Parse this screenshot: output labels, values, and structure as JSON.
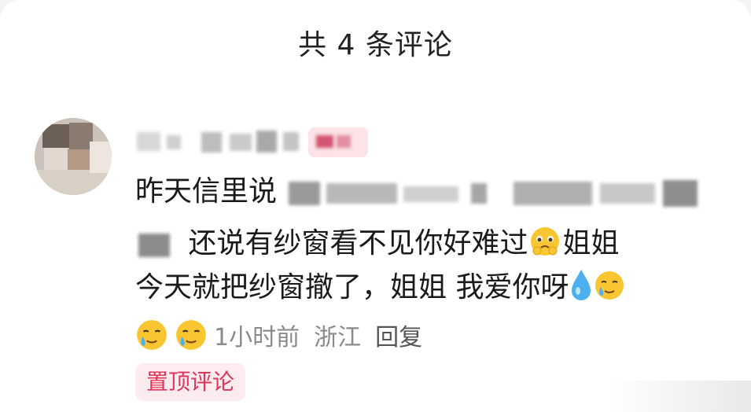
{
  "header": {
    "title": "共 4 条评论"
  },
  "comment": {
    "line1_text": "昨天信里说",
    "line2_text": "还说有纱窗看不见你好难过",
    "line2_tail": "姐姐",
    "line3_text": "今天就把纱窗撤了，姐姐 我爱你呀",
    "emojis": [
      "holding-back-tears-emoji",
      "droplet-icon",
      "sad-smile-emoji",
      "sad-smile-emoji"
    ]
  },
  "meta": {
    "time": "1小时前",
    "location": "浙江",
    "reply_label": "回复"
  },
  "pinned_badge": "置顶评论",
  "colors": {
    "pin_text": "#e0345a",
    "pin_bg": "#fdecef",
    "meta_text": "#8a8a8a"
  }
}
